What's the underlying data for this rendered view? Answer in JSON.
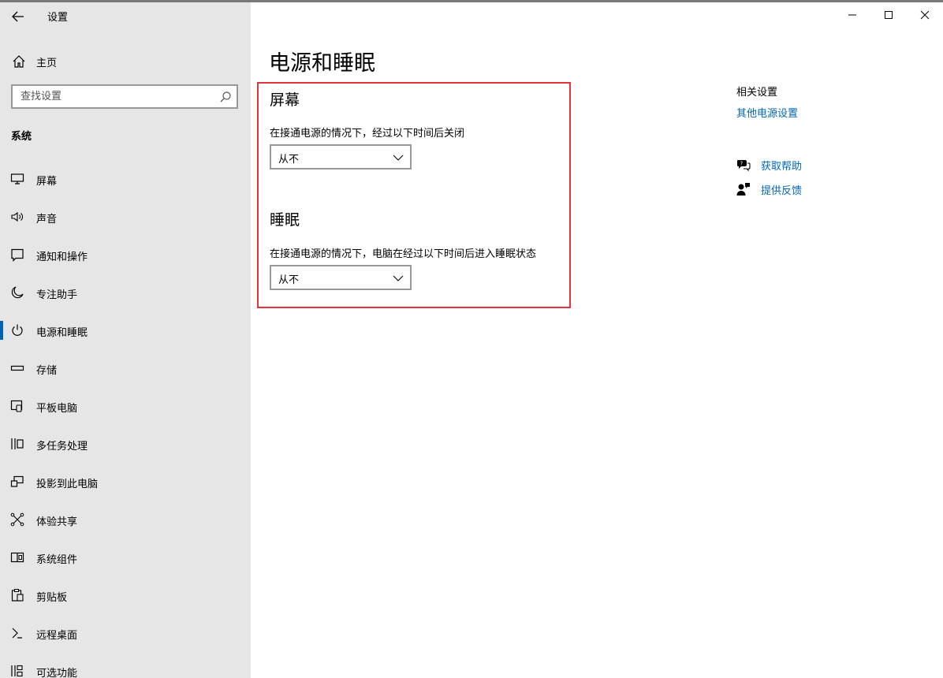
{
  "window": {
    "title": "设置",
    "controls": [
      "minimize-icon",
      "maximize-icon",
      "close-icon"
    ]
  },
  "sidebar": {
    "home_label": "主页",
    "search": {
      "placeholder": "查找设置",
      "value": ""
    },
    "section_label": "系统",
    "items": [
      {
        "label": "屏幕",
        "icon": "monitor-icon"
      },
      {
        "label": "声音",
        "icon": "speaker-icon"
      },
      {
        "label": "通知和操作",
        "icon": "notification-icon"
      },
      {
        "label": "专注助手",
        "icon": "moon-icon"
      },
      {
        "label": "电源和睡眠",
        "icon": "power-icon",
        "active": true
      },
      {
        "label": "存储",
        "icon": "storage-icon"
      },
      {
        "label": "平板电脑",
        "icon": "tablet-icon"
      },
      {
        "label": "多任务处理",
        "icon": "multitask-icon"
      },
      {
        "label": "投影到此电脑",
        "icon": "project-icon"
      },
      {
        "label": "体验共享",
        "icon": "share-icon"
      },
      {
        "label": "系统组件",
        "icon": "components-icon"
      },
      {
        "label": "剪贴板",
        "icon": "clipboard-icon"
      },
      {
        "label": "远程桌面",
        "icon": "remote-icon"
      },
      {
        "label": "可选功能",
        "icon": "optional-features-icon"
      }
    ]
  },
  "main": {
    "title": "电源和睡眠",
    "screen": {
      "heading": "屏幕",
      "label": "在接通电源的情况下，经过以下时间后关闭",
      "selected": "从不"
    },
    "sleep": {
      "heading": "睡眠",
      "label": "在接通电源的情况下，电脑在经过以下时间后进入睡眠状态",
      "selected": "从不"
    },
    "highlight_color": "#e0353d"
  },
  "related": {
    "title": "相关设置",
    "link": "其他电源设置",
    "help": "获取帮助",
    "feedback": "提供反馈",
    "link_color": "#0067b8"
  },
  "accent_color": "#0063b1"
}
